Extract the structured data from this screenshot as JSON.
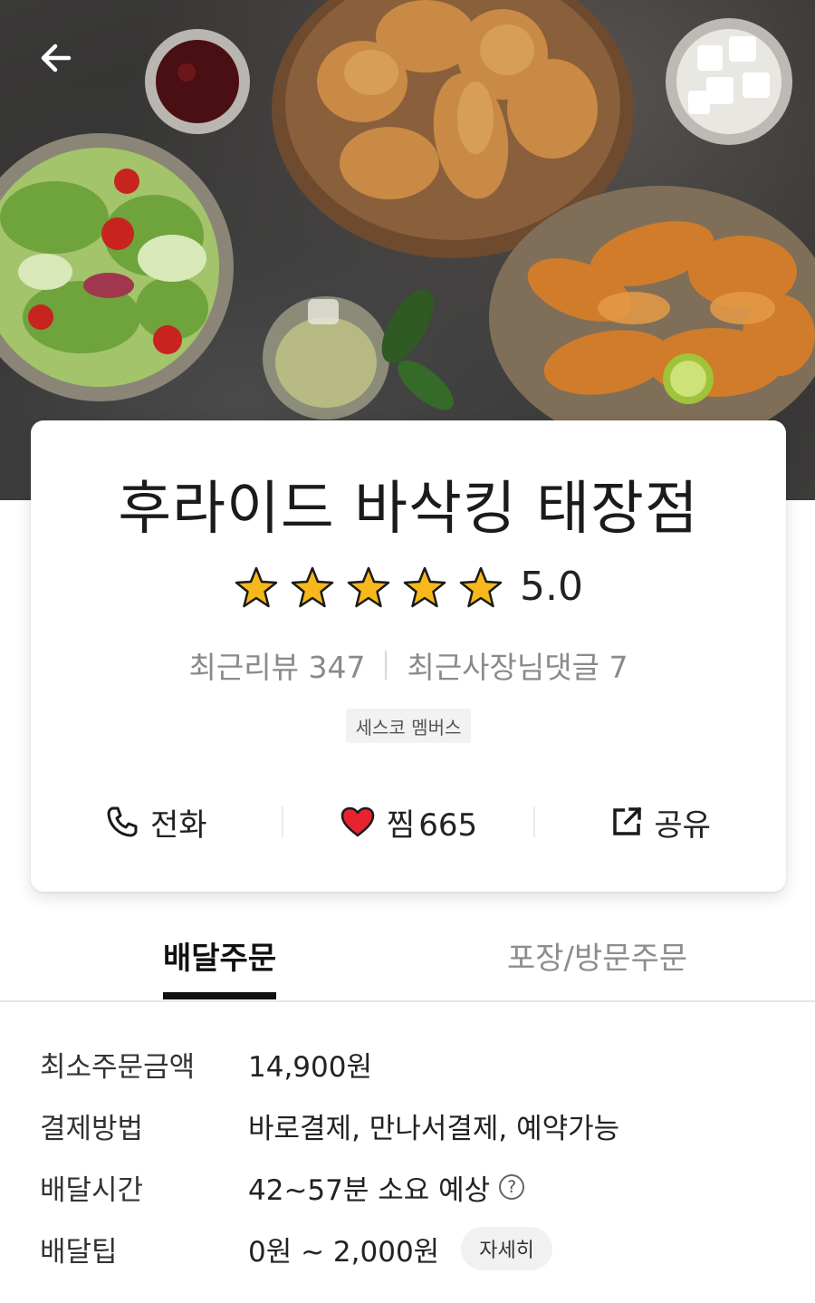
{
  "header": {
    "back_icon": "arrow-left-icon"
  },
  "store": {
    "name": "후라이드 바삭킹 태장점",
    "rating": "5.0",
    "stars": 5,
    "recent_reviews_label": "최근리뷰 347",
    "owner_replies_label": "최근사장님댓글 7",
    "badge": "세스코 멤버스"
  },
  "actions": {
    "call_label": "전화",
    "call_icon": "phone-icon",
    "like_label": "찜",
    "like_count": "665",
    "like_icon": "heart-icon",
    "share_label": "공유",
    "share_icon": "share-icon"
  },
  "tabs": [
    {
      "label": "배달주문",
      "active": true
    },
    {
      "label": "포장/방문주문",
      "active": false
    }
  ],
  "info": {
    "min_order_label": "최소주문금액",
    "min_order_value": "14,900원",
    "payment_label": "결제방법",
    "payment_value": "바로결제, 만나서결제, 예약가능",
    "delivery_time_label": "배달시간",
    "delivery_time_value": "42~57분 소요 예상",
    "delivery_tip_label": "배달팁",
    "delivery_tip_value": "0원 ~ 2,000원",
    "detail_button": "자세히"
  },
  "colors": {
    "heart": "#e8232f",
    "star": "#f6b81a",
    "tab_indicator": "#111111"
  }
}
